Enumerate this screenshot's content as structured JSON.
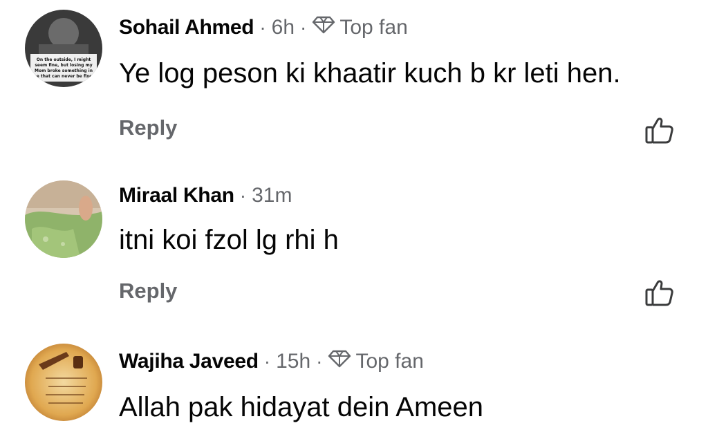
{
  "comments": [
    {
      "author": "Sohail Ahmed",
      "time": "6h",
      "badge": "Top fan",
      "text": "Ye log peson ki khaatir kuch b kr leti hen.",
      "reply_label": "Reply",
      "avatar_caption": "On the outside, I might seem fine, but losing my Mom broke something in me that can never be fixed"
    },
    {
      "author": "Miraal Khan",
      "time": "31m",
      "text": "itni koi fzol lg rhi h",
      "reply_label": "Reply"
    },
    {
      "author": "Wajiha Javeed",
      "time": "15h",
      "badge": "Top fan",
      "text": "Allah pak hidayat dein Ameen"
    }
  ],
  "icons": {
    "badge": "diamond-icon",
    "like": "thumbs-up-icon"
  },
  "colors": {
    "text": "#050505",
    "secondary": "#65676b"
  }
}
